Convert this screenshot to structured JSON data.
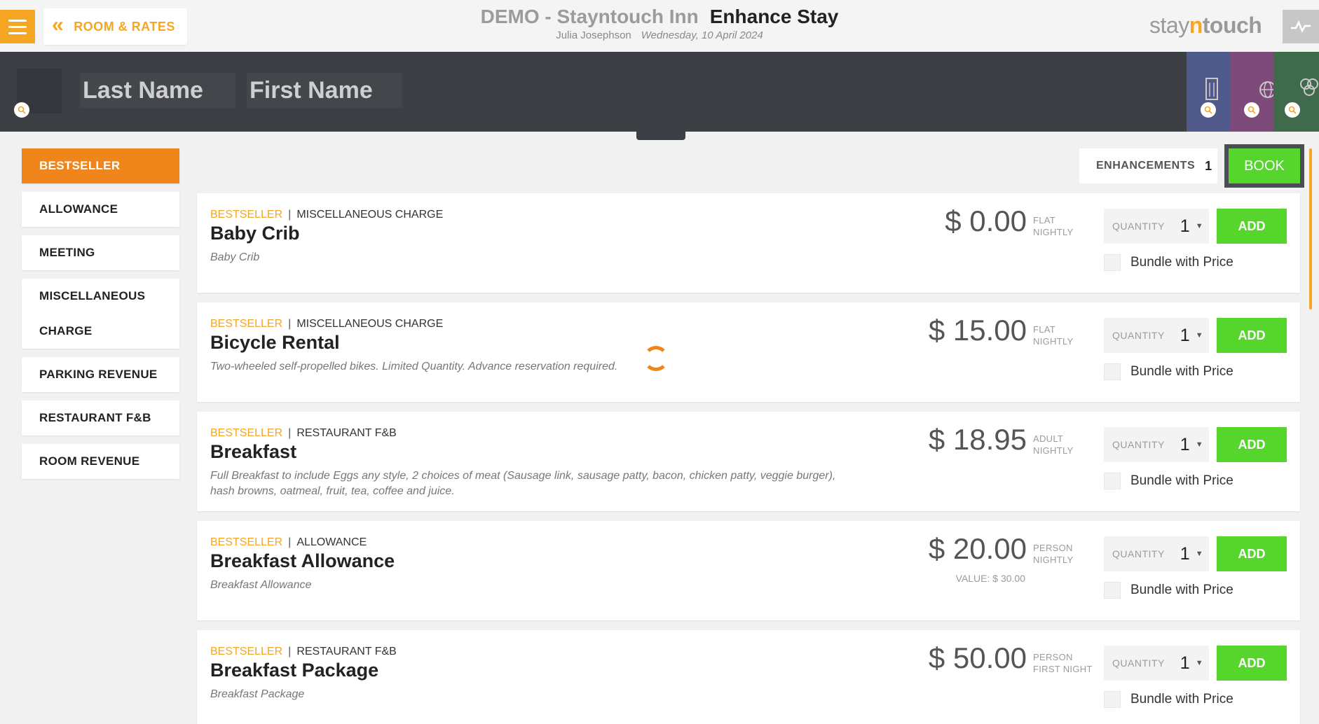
{
  "header": {
    "back_label": "ROOM & RATES",
    "hotel_name": "DEMO - Stayntouch Inn",
    "page_title": "Enhance Stay",
    "guest_name": "Julia Josephson",
    "date": "Wednesday, 10 April 2024",
    "logo": {
      "part1": "stay",
      "part2": "n",
      "part3": "touch"
    }
  },
  "search": {
    "last_name_placeholder": "Last Name",
    "first_name_placeholder": "First Name"
  },
  "categories": [
    {
      "label": "BESTSELLER",
      "active": true
    },
    {
      "label": "ALLOWANCE",
      "active": false
    },
    {
      "label": "MEETING",
      "active": false
    },
    {
      "label": "MISCELLANEOUS CHARGE",
      "active": false
    },
    {
      "label": "PARKING REVENUE",
      "active": false
    },
    {
      "label": "RESTAURANT F&B",
      "active": false
    },
    {
      "label": "ROOM REVENUE",
      "active": false
    }
  ],
  "actions": {
    "enhancements_label": "ENHANCEMENTS",
    "enhancements_count": "1",
    "book_label": "BOOK"
  },
  "items": [
    {
      "tag1": "BESTSELLER",
      "sep": "|",
      "tag2": "MISCELLANEOUS CHARGE",
      "name": "Baby Crib",
      "desc": "Baby Crib",
      "price": "$ 0.00",
      "unit1": "FLAT",
      "unit2": "NIGHTLY",
      "value": "",
      "qty_label": "QUANTITY",
      "qty": "1",
      "add": "ADD",
      "bundle": "Bundle with Price"
    },
    {
      "tag1": "BESTSELLER",
      "sep": "|",
      "tag2": "MISCELLANEOUS CHARGE",
      "name": "Bicycle Rental",
      "desc": "Two-wheeled self-propelled bikes. Limited Quantity. Advance reservation required.",
      "price": "$ 15.00",
      "unit1": "FLAT",
      "unit2": "NIGHTLY",
      "value": "",
      "qty_label": "QUANTITY",
      "qty": "1",
      "add": "ADD",
      "bundle": "Bundle with Price"
    },
    {
      "tag1": "BESTSELLER",
      "sep": "|",
      "tag2": "RESTAURANT F&B",
      "name": "Breakfast",
      "desc": "Full Breakfast to include Eggs any style, 2 choices of meat (Sausage link, sausage patty, bacon, chicken patty, veggie burger), hash browns, oatmeal, fruit, tea, coffee and juice.",
      "price": "$ 18.95",
      "unit1": "ADULT",
      "unit2": "NIGHTLY",
      "value": "",
      "qty_label": "QUANTITY",
      "qty": "1",
      "add": "ADD",
      "bundle": "Bundle with Price"
    },
    {
      "tag1": "BESTSELLER",
      "sep": "|",
      "tag2": "ALLOWANCE",
      "name": "Breakfast Allowance",
      "desc": "Breakfast Allowance",
      "price": "$ 20.00",
      "unit1": "PERSON",
      "unit2": "NIGHTLY",
      "value": "VALUE: $ 30.00",
      "qty_label": "QUANTITY",
      "qty": "1",
      "add": "ADD",
      "bundle": "Bundle with Price"
    },
    {
      "tag1": "BESTSELLER",
      "sep": "|",
      "tag2": "RESTAURANT F&B",
      "name": "Breakfast Package",
      "desc": "Breakfast Package",
      "price": "$ 50.00",
      "unit1": "PERSON",
      "unit2": "FIRST NIGHT",
      "value": "",
      "qty_label": "QUANTITY",
      "qty": "1",
      "add": "ADD",
      "bundle": "Bundle with Price"
    }
  ],
  "colors": {
    "accent_orange": "#f0861b",
    "add_green": "#56d62c",
    "search_band": "#3c3f44"
  }
}
